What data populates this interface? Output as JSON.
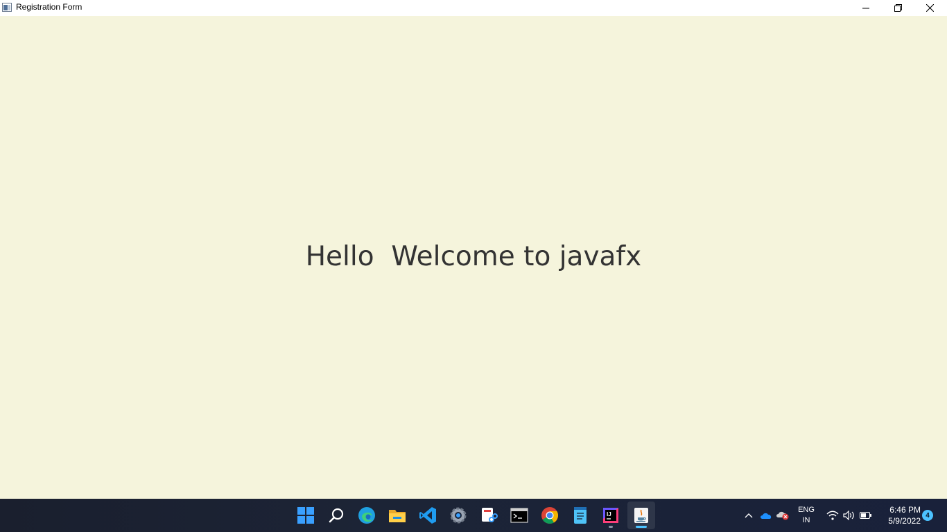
{
  "window": {
    "title": "Registration Form"
  },
  "content": {
    "welcome_text": "Hello  Welcome to javafx",
    "background": "#f5f4dc"
  },
  "taskbar": {
    "apps": [
      {
        "name": "start-icon"
      },
      {
        "name": "search-icon"
      },
      {
        "name": "edge-icon"
      },
      {
        "name": "file-explorer-icon"
      },
      {
        "name": "vscode-icon"
      },
      {
        "name": "settings-icon"
      },
      {
        "name": "snipping-tool-icon"
      },
      {
        "name": "terminal-icon"
      },
      {
        "name": "chrome-icon"
      },
      {
        "name": "notepad-icon"
      },
      {
        "name": "intellij-icon",
        "running": true
      },
      {
        "name": "java-icon",
        "active": true
      }
    ],
    "tray": {
      "lang_top": "ENG",
      "lang_bottom": "IN",
      "time": "6:46 PM",
      "date": "5/9/2022",
      "notification_count": "4"
    }
  }
}
